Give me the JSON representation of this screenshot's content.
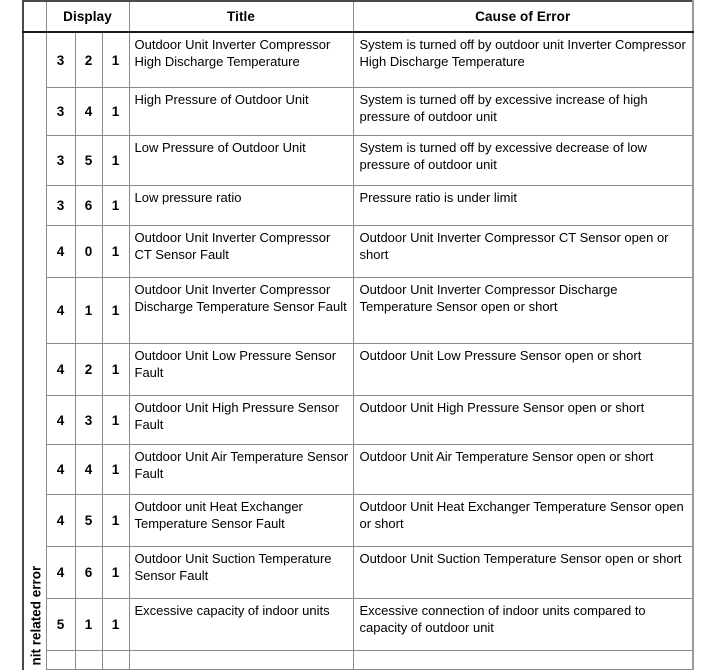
{
  "document": {
    "group_label": "nit related error"
  },
  "table": {
    "headers": {
      "group": "",
      "display": "Display",
      "title": "Title",
      "cause": "Cause of Error"
    },
    "rows": [
      {
        "d1": "3",
        "d2": "2",
        "d3": "1",
        "title": "Outdoor Unit Inverter Compressor High Discharge Temperature",
        "cause": "System is turned off by outdoor unit Inverter Compressor High Discharge Temperature"
      },
      {
        "d1": "3",
        "d2": "4",
        "d3": "1",
        "title": "High Pressure of Outdoor Unit",
        "cause": "System is turned off by excessive increase of high pressure of outdoor unit"
      },
      {
        "d1": "3",
        "d2": "5",
        "d3": "1",
        "title": "Low Pressure of Outdoor Unit",
        "cause": "System is turned off by excessive decrease of low pressure of outdoor unit"
      },
      {
        "d1": "3",
        "d2": "6",
        "d3": "1",
        "title": "Low pressure ratio",
        "cause": "Pressure ratio is under limit"
      },
      {
        "d1": "4",
        "d2": "0",
        "d3": "1",
        "title": "Outdoor Unit Inverter Compressor CT Sensor Fault",
        "cause": "Outdoor Unit Inverter Compressor CT Sensor open or short"
      },
      {
        "d1": "4",
        "d2": "1",
        "d3": "1",
        "title": "Outdoor Unit Inverter Compressor Discharge Temperature Sensor Fault",
        "cause": "Outdoor Unit Inverter Compressor Discharge Temperature Sensor open or short"
      },
      {
        "d1": "4",
        "d2": "2",
        "d3": "1",
        "title": "Outdoor Unit Low Pressure Sensor Fault",
        "cause": "Outdoor Unit Low Pressure Sensor open or short"
      },
      {
        "d1": "4",
        "d2": "3",
        "d3": "1",
        "title": "Outdoor Unit High Pressure Sensor Fault",
        "cause": "Outdoor Unit High Pressure Sensor open or short"
      },
      {
        "d1": "4",
        "d2": "4",
        "d3": "1",
        "title": "Outdoor Unit Air Temperature Sensor Fault",
        "cause": "Outdoor Unit Air Temperature Sensor open or short"
      },
      {
        "d1": "4",
        "d2": "5",
        "d3": "1",
        "title": "Outdoor unit Heat Exchanger Temperature Sensor Fault",
        "cause": "Outdoor Unit Heat Exchanger Temperature Sensor open or short"
      },
      {
        "d1": "4",
        "d2": "6",
        "d3": "1",
        "title": "Outdoor Unit Suction Temperature Sensor Fault",
        "cause": "Outdoor Unit Suction Temperature Sensor open or short"
      },
      {
        "d1": "5",
        "d2": "1",
        "d3": "1",
        "title": "Excessive capacity of indoor units",
        "cause": "Excessive connection of indoor units compared to capacity of outdoor unit"
      },
      {
        "d1": "",
        "d2": "",
        "d3": "",
        "title": "",
        "cause": ""
      }
    ]
  }
}
